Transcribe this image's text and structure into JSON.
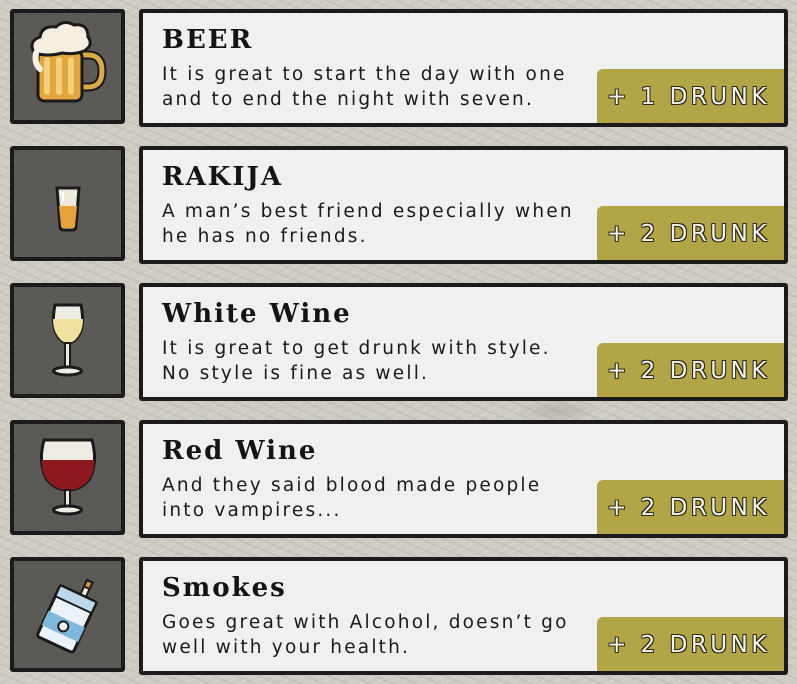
{
  "items": [
    {
      "title": "BEER",
      "description": "It is great to start the day with one\nand to end the night with seven.",
      "badge": "+ 1 DRUNK",
      "icon": "beer-mug-icon"
    },
    {
      "title": "RAKIJA",
      "description": "A man’s best friend especially when\nhe has no friends.",
      "badge": "+ 2 DRUNK",
      "icon": "shot-glass-icon"
    },
    {
      "title": "White Wine",
      "description": "It is great to get drunk with style.\nNo style is fine as well.",
      "badge": "+ 2 DRUNK",
      "icon": "white-wine-glass-icon"
    },
    {
      "title": "Red Wine",
      "description": "And they said blood made people\ninto vampires...",
      "badge": "+ 2 DRUNK",
      "icon": "red-wine-glass-icon"
    },
    {
      "title": "Smokes",
      "description": "Goes great with Alcohol, doesn’t go\nwell with your health.",
      "badge": "+ 2 DRUNK",
      "icon": "cigarette-pack-icon"
    }
  ],
  "colors": {
    "background": "#cfcbc2",
    "icon_box": "#5c5a56",
    "card": "#f0f0f0",
    "border": "#1b1b1b",
    "badge": "#b2a548",
    "badge_text": "#f5f3e6"
  }
}
